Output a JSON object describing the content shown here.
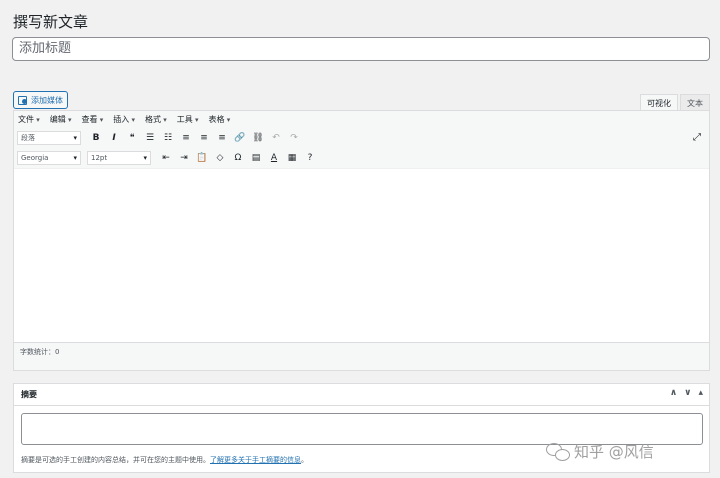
{
  "page": {
    "title": "撰写新文章"
  },
  "title_input": {
    "placeholder": "添加标题"
  },
  "media_button": {
    "label": "添加媒体",
    "icon": "add-media-icon"
  },
  "mode_tabs": [
    {
      "label": "可视化",
      "active": true
    },
    {
      "label": "文本",
      "active": false
    }
  ],
  "menubar": [
    "文件",
    "编辑",
    "查看",
    "插入",
    "格式",
    "工具",
    "表格"
  ],
  "toolbar1": {
    "format_select": "段落",
    "buttons": [
      "B",
      "I",
      "❝",
      "☰",
      "☷",
      "≡",
      "≡",
      "≡",
      "🔗",
      "⛓",
      "↶",
      "↷"
    ],
    "fullscreen": "⤢"
  },
  "toolbar2": {
    "font_select": "Georgia",
    "size_select": "12pt",
    "buttons": [
      "⇤",
      "⇥",
      "📋",
      "◇",
      "Ω",
      "▤",
      "A",
      "▦",
      "?"
    ]
  },
  "status": {
    "word_count": "字数统计：0"
  },
  "excerpt": {
    "title": "摘要",
    "controls": [
      "∧",
      "∨",
      "▴"
    ],
    "help_text": "摘要是可选的手工创建的内容总结，并可在您的主题中使用。",
    "help_link": "了解更多关于手工摘要的信息",
    "help_end": "。"
  },
  "watermark": {
    "text": "知乎 @风信"
  },
  "colors": {
    "accent": "#2271b1",
    "border": "#dcdcde",
    "bg": "#f1f1f1"
  }
}
